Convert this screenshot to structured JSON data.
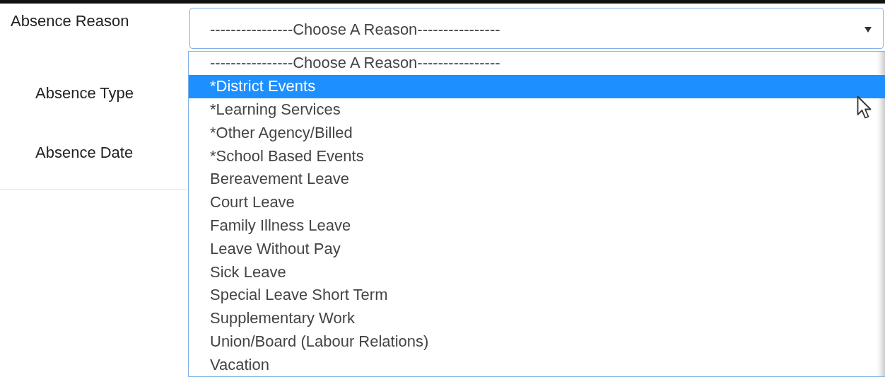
{
  "fields": [
    {
      "label": "Absence Reason"
    },
    {
      "label": "Absence Type"
    },
    {
      "label": "Absence Date"
    }
  ],
  "select": {
    "value": "----------------Choose A Reason----------------",
    "expanded": true
  },
  "options": [
    {
      "label": "----------------Choose A Reason----------------",
      "selected": false
    },
    {
      "label": "*District Events",
      "selected": true
    },
    {
      "label": "*Learning Services",
      "selected": false
    },
    {
      "label": "*Other Agency/Billed",
      "selected": false
    },
    {
      "label": "*School Based Events",
      "selected": false
    },
    {
      "label": "Bereavement Leave",
      "selected": false
    },
    {
      "label": "Court Leave",
      "selected": false
    },
    {
      "label": "Family Illness Leave",
      "selected": false
    },
    {
      "label": "Leave Without Pay",
      "selected": false
    },
    {
      "label": "Sick Leave",
      "selected": false
    },
    {
      "label": "Special Leave Short Term",
      "selected": false
    },
    {
      "label": "Supplementary Work",
      "selected": false
    },
    {
      "label": "Union/Board (Labour Relations)",
      "selected": false
    },
    {
      "label": "Vacation",
      "selected": false
    }
  ]
}
